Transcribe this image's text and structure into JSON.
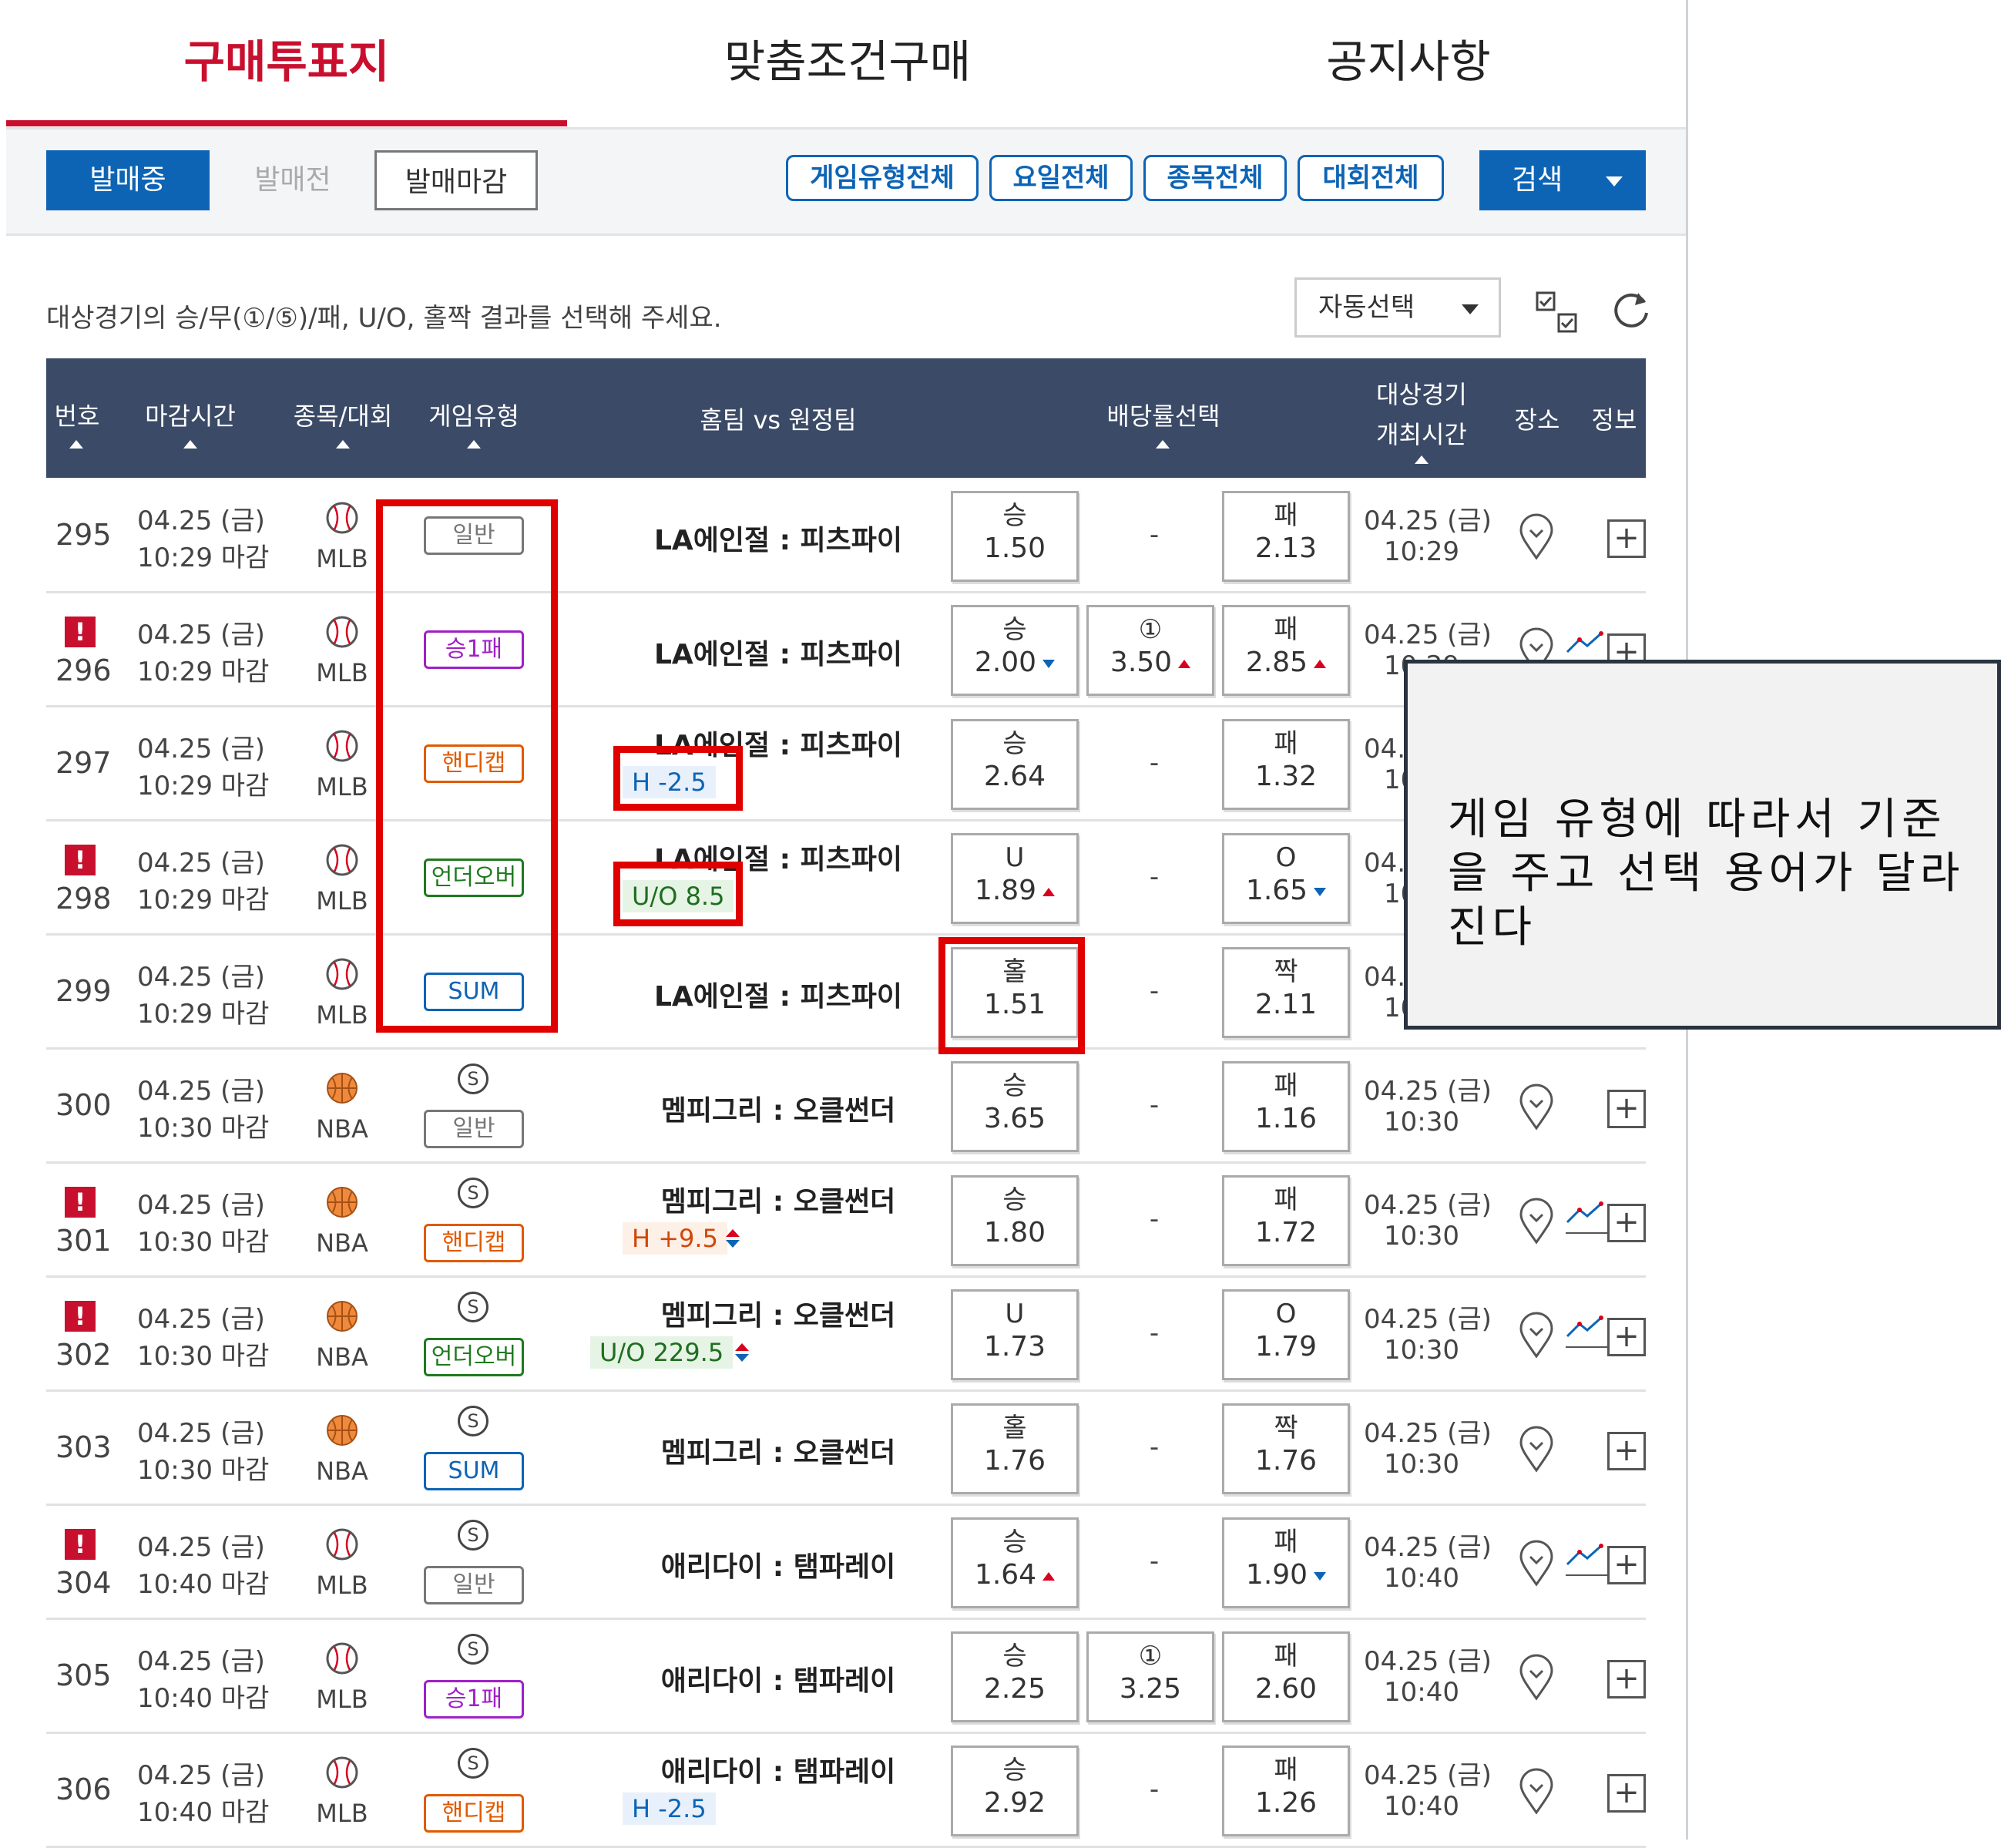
{
  "tabs": [
    "구매투표지",
    "맞춤조건구매",
    "공지사항"
  ],
  "filters": {
    "status": [
      "발매중",
      "발매전",
      "발매마감"
    ],
    "pills": [
      "게임유형전체",
      "요일전체",
      "종목전체",
      "대회전체"
    ],
    "search": "검색"
  },
  "instruction": "대상경기의 승/무(①/⑤)/패, U/O, 홀짝 결과를 선택해 주세요.",
  "auto_select": "자동선택",
  "headers": {
    "num": "번호",
    "deadline": "마감시간",
    "sport": "종목/대회",
    "type": "게임유형",
    "teams": "홈팀 vs 원정팀",
    "odds": "배당률선택",
    "gametime1": "대상경기",
    "gametime2": "개최시간",
    "venue": "장소",
    "info": "정보"
  },
  "rows": [
    {
      "num": "295",
      "warn": false,
      "t1": "04.25 (금)",
      "t2": "10:29 마감",
      "sport": "MLB",
      "icon": "baseball",
      "s": false,
      "type": "일반",
      "match": "LA에인절 : 피츠파이",
      "handi": "",
      "o1a": "승",
      "o1b": "1.50",
      "o1c": "",
      "o2a": "",
      "o2b": "",
      "o2c": "",
      "o3a": "패",
      "o3b": "2.13",
      "o3c": "",
      "g1": "04.25 (금)",
      "g2": "10:29",
      "trend": false
    },
    {
      "num": "296",
      "warn": true,
      "t1": "04.25 (금)",
      "t2": "10:29 마감",
      "sport": "MLB",
      "icon": "baseball",
      "s": false,
      "type": "승1패",
      "match": "LA에인절 : 피츠파이",
      "handi": "",
      "o1a": "승",
      "o1b": "2.00",
      "o1c": "dn",
      "o2a": "①",
      "o2b": "3.50",
      "o2c": "up",
      "o3a": "패",
      "o3b": "2.85",
      "o3c": "up",
      "g1": "04.25 (금)",
      "g2": "10:29",
      "trend": true
    },
    {
      "num": "297",
      "warn": false,
      "t1": "04.25 (금)",
      "t2": "10:29 마감",
      "sport": "MLB",
      "icon": "baseball",
      "s": false,
      "type": "핸디캡",
      "match": "LA에인절 : 피츠파이",
      "handi": "H -2.5",
      "o1a": "승",
      "o1b": "2.64",
      "o1c": "",
      "o2a": "",
      "o2b": "",
      "o2c": "",
      "o3a": "패",
      "o3b": "1.32",
      "o3c": "",
      "g1": "04.25 (금)",
      "g2": "10:29",
      "trend": false
    },
    {
      "num": "298",
      "warn": true,
      "t1": "04.25 (금)",
      "t2": "10:29 마감",
      "sport": "MLB",
      "icon": "baseball",
      "s": false,
      "type": "언더오버",
      "match": "LA에인절 : 피츠파이",
      "handi": "U/O 8.5",
      "o1a": "U",
      "o1b": "1.89",
      "o1c": "up",
      "o2a": "",
      "o2b": "",
      "o2c": "",
      "o3a": "O",
      "o3b": "1.65",
      "o3c": "dn",
      "g1": "04.25 (금)",
      "g2": "10:29",
      "trend": false
    },
    {
      "num": "299",
      "warn": false,
      "t1": "04.25 (금)",
      "t2": "10:29 마감",
      "sport": "MLB",
      "icon": "baseball",
      "s": false,
      "type": "SUM",
      "match": "LA에인절 : 피츠파이",
      "handi": "",
      "o1a": "홀",
      "o1b": "1.51",
      "o1c": "",
      "o2a": "",
      "o2b": "",
      "o2c": "",
      "o3a": "짝",
      "o3b": "2.11",
      "o3c": "",
      "g1": "04.25 (금)",
      "g2": "10:29",
      "trend": false
    },
    {
      "num": "300",
      "warn": false,
      "t1": "04.25 (금)",
      "t2": "10:30 마감",
      "sport": "NBA",
      "icon": "basketball",
      "s": true,
      "type": "일반",
      "match": "멤피그리 : 오클썬더",
      "handi": "",
      "o1a": "승",
      "o1b": "3.65",
      "o1c": "",
      "o2a": "",
      "o2b": "",
      "o2c": "",
      "o3a": "패",
      "o3b": "1.16",
      "o3c": "",
      "g1": "04.25 (금)",
      "g2": "10:30",
      "trend": false
    },
    {
      "num": "301",
      "warn": true,
      "t1": "04.25 (금)",
      "t2": "10:30 마감",
      "sport": "NBA",
      "icon": "basketball",
      "s": true,
      "type": "핸디캡",
      "match": "멤피그리 : 오클썬더",
      "handi": "H +9.5",
      "o1a": "승",
      "o1b": "1.80",
      "o1c": "",
      "o2a": "",
      "o2b": "",
      "o2c": "",
      "o3a": "패",
      "o3b": "1.72",
      "o3c": "",
      "g1": "04.25 (금)",
      "g2": "10:30",
      "trend": true
    },
    {
      "num": "302",
      "warn": true,
      "t1": "04.25 (금)",
      "t2": "10:30 마감",
      "sport": "NBA",
      "icon": "basketball",
      "s": true,
      "type": "언더오버",
      "match": "멤피그리 : 오클썬더",
      "handi": "U/O 229.5",
      "o1a": "U",
      "o1b": "1.73",
      "o1c": "",
      "o2a": "",
      "o2b": "",
      "o2c": "",
      "o3a": "O",
      "o3b": "1.79",
      "o3c": "",
      "g1": "04.25 (금)",
      "g2": "10:30",
      "trend": true
    },
    {
      "num": "303",
      "warn": false,
      "t1": "04.25 (금)",
      "t2": "10:30 마감",
      "sport": "NBA",
      "icon": "basketball",
      "s": true,
      "type": "SUM",
      "match": "멤피그리 : 오클썬더",
      "handi": "",
      "o1a": "홀",
      "o1b": "1.76",
      "o1c": "",
      "o2a": "",
      "o2b": "",
      "o2c": "",
      "o3a": "짝",
      "o3b": "1.76",
      "o3c": "",
      "g1": "04.25 (금)",
      "g2": "10:30",
      "trend": false
    },
    {
      "num": "304",
      "warn": true,
      "t1": "04.25 (금)",
      "t2": "10:40 마감",
      "sport": "MLB",
      "icon": "baseball",
      "s": true,
      "type": "일반",
      "match": "애리다이 : 탬파레이",
      "handi": "",
      "o1a": "승",
      "o1b": "1.64",
      "o1c": "up",
      "o2a": "",
      "o2b": "",
      "o2c": "",
      "o3a": "패",
      "o3b": "1.90",
      "o3c": "dn",
      "g1": "04.25 (금)",
      "g2": "10:40",
      "trend": true
    },
    {
      "num": "305",
      "warn": false,
      "t1": "04.25 (금)",
      "t2": "10:40 마감",
      "sport": "MLB",
      "icon": "baseball",
      "s": true,
      "type": "승1패",
      "match": "애리다이 : 탬파레이",
      "handi": "",
      "o1a": "승",
      "o1b": "2.25",
      "o1c": "",
      "o2a": "①",
      "o2b": "3.25",
      "o2c": "",
      "o3a": "패",
      "o3b": "2.60",
      "o3c": "",
      "g1": "04.25 (금)",
      "g2": "10:40",
      "trend": false
    },
    {
      "num": "306",
      "warn": false,
      "t1": "04.25 (금)",
      "t2": "10:40 마감",
      "sport": "MLB",
      "icon": "baseball",
      "s": true,
      "type": "핸디캡",
      "match": "애리다이 : 탬파레이",
      "handi": "H -2.5",
      "o1a": "승",
      "o1b": "2.92",
      "o1c": "",
      "o2a": "",
      "o2b": "",
      "o2c": "",
      "o3a": "패",
      "o3b": "1.26",
      "o3c": "",
      "g1": "04.25 (금)",
      "g2": "10:40",
      "trend": false
    }
  ],
  "type_colors": {
    "일반": "#777777",
    "승1패": "#a020c8",
    "핸디캡": "#e05a00",
    "언더오버": "#1f7a1f",
    "SUM": "#0d64b5"
  },
  "warn_mark": "!",
  "s_mark": "S",
  "dash": "-",
  "plus": "+",
  "callout": "게임 유형에 따라서 기준을 주고 선택 용어가 달라진다"
}
